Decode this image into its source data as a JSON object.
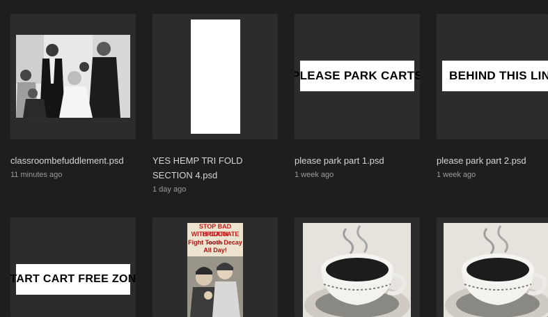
{
  "files": [
    {
      "name": "classroombefuddlement.psd",
      "time": "11 minutes ago",
      "thumb": "photo-classroom"
    },
    {
      "name": "YES HEMP TRI FOLD SECTION 4.psd",
      "time": "1 day ago",
      "thumb": "blank-page"
    },
    {
      "name": "please park part 1.psd",
      "time": "1 week ago",
      "thumb": "sign",
      "sign_text": "PLEASE PARK CARTS"
    },
    {
      "name": "please park part 2.psd",
      "time": "1 week ago",
      "thumb": "sign",
      "sign_text": "BEHIND THIS LINE"
    },
    {
      "thumb": "sign",
      "sign_text": "START CART FREE ZONE"
    },
    {
      "thumb": "colgate-ad",
      "ad_lines": [
        "STOP BAD BREATH",
        "WITH COLGATE",
        "Fight Tooth Decay",
        "All Day!"
      ],
      "ad_small": "WHILE YOU"
    },
    {
      "thumb": "coffee-cup"
    },
    {
      "thumb": "coffee-cup"
    }
  ],
  "colors": {
    "background": "#1e1e1e",
    "card": "#2c2c2c",
    "name_text": "#d6d6d6",
    "time_text": "#9a9a9a",
    "ad_red": "#c8191b"
  }
}
